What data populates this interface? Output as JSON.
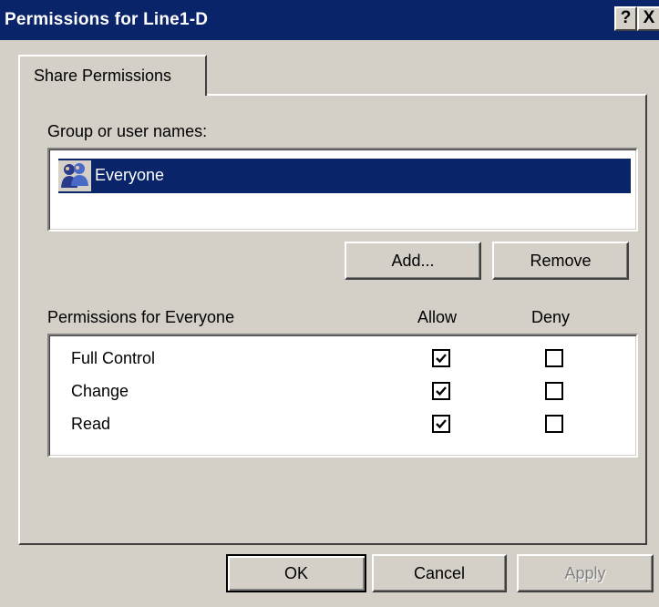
{
  "window": {
    "title": "Permissions for Line1-D",
    "help_glyph": "?",
    "close_glyph": "X"
  },
  "tabs": [
    {
      "label": "Share Permissions",
      "active": true
    }
  ],
  "users": {
    "label": "Group or user names:",
    "items": [
      {
        "name": "Everyone",
        "icon": "user-group-icon",
        "selected": true
      }
    ],
    "add_button": "Add...",
    "remove_button": "Remove"
  },
  "permissions": {
    "header": "Permissions for Everyone",
    "allow_label": "Allow",
    "deny_label": "Deny",
    "rows": [
      {
        "name": "Full Control",
        "allow": true,
        "deny": false
      },
      {
        "name": "Change",
        "allow": true,
        "deny": false
      },
      {
        "name": "Read",
        "allow": true,
        "deny": false
      }
    ]
  },
  "footer": {
    "ok": "OK",
    "cancel": "Cancel",
    "apply": "Apply",
    "apply_enabled": false
  },
  "colors": {
    "title_bar": "#0a246a",
    "face": "#d4d0c8",
    "selection": "#0a246a"
  }
}
